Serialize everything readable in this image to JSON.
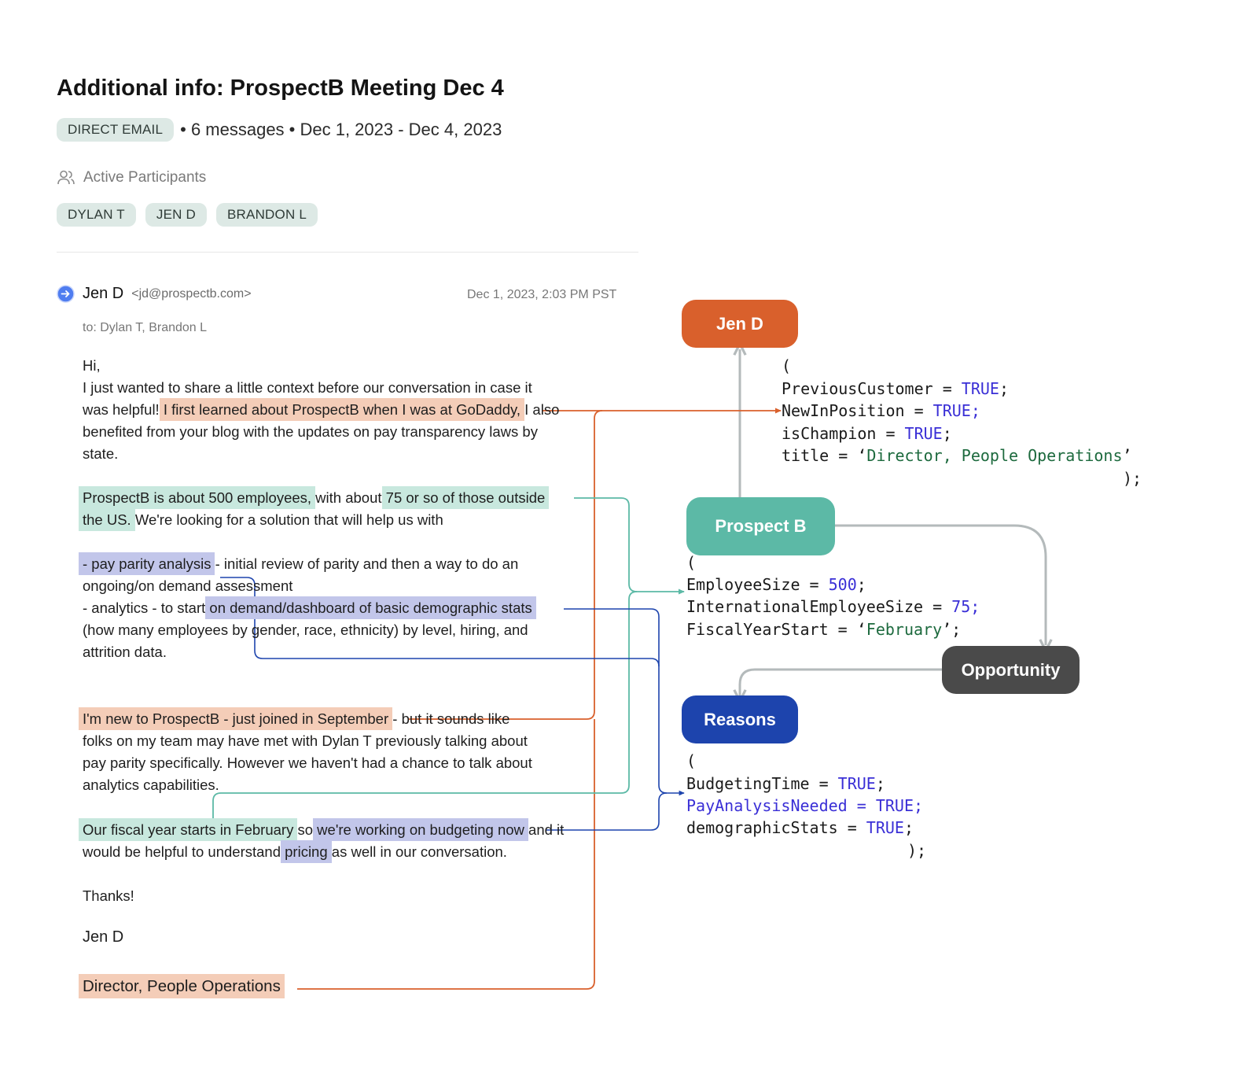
{
  "header": {
    "title": "Additional info: ProspectB Meeting Dec 4",
    "channel_tag": "DIRECT EMAIL",
    "meta": "• 6 messages • Dec 1, 2023 - Dec 4, 2023"
  },
  "participants": {
    "heading": "Active Participants",
    "chips": [
      "DYLAN T",
      "JEN D",
      "BRANDON L"
    ]
  },
  "email": {
    "sender_name": "Jen D",
    "sender_email": "<jd@prospectb.com>",
    "date": "Dec 1, 2023, 2:03 PM PST",
    "to": "to: Dylan T, Brandon L",
    "greeting": "Hi,",
    "p1_l1": "I just wanted to share a little context before our conversation in case it",
    "p1_l2a": "was helpful! ",
    "p1_l2_hl": "I first learned about ProspectB when I was at GoDaddy,",
    "p1_l2b": " I also",
    "p1_l3": "benefited from your blog with the updates on pay transparency laws by",
    "p1_l4": "state.",
    "p2_l1_hl1": "ProspectB is about 500 employees,",
    "p2_l1_mid": " with about ",
    "p2_l1_hl2": "75 or so of those outside",
    "p2_l2_hl": "the US.",
    "p2_l2b": " We're looking for a solution that will help us with",
    "p3_l1_hl": "- pay parity analysis",
    "p3_l1b": " - initial review of parity and then a way to do an",
    "p3_l2": "ongoing/on demand assessment",
    "p3_l3a": "- analytics - to start ",
    "p3_l3_hl": "on demand/dashboard of basic demographic stats",
    "p3_l4": "(how many employees by gender, race, ethnicity) by level, hiring, and",
    "p3_l5": "attrition data.",
    "p4_l1_hl": "I'm new to ProspectB - just joined in September",
    "p4_l1b": " - but it sounds like",
    "p4_l2": "folks on my team may have met with Dylan T previously talking about",
    "p4_l3": "pay parity specifically. However we haven't had a chance to talk about",
    "p4_l4": "analytics capabilities.",
    "p5_l1_hl1": "Our fiscal year starts in February",
    "p5_l1_mid": " so ",
    "p5_l1_hl2": "we're working on budgeting now",
    "p5_l1b": " and it",
    "p5_l2a": "would be helpful to understand ",
    "p5_l2_hl": "pricing",
    "p5_l2b": " as well in our conversation.",
    "thanks": "Thanks!",
    "signature": "Jen D",
    "title_hl": "Director, People Operations"
  },
  "diagram": {
    "nodes": {
      "jen_d": "Jen D",
      "prospect_b": "Prospect B",
      "opportunity": "Opportunity",
      "reasons": "Reasons"
    },
    "jen_code": {
      "open": "(",
      "l1_key": "PreviousCustomer = ",
      "l1_val": "TRUE",
      "l1_end": ";",
      "l2_key": "NewInPosition = ",
      "l2_val": "TRUE;",
      "l3_key": "isChampion = ",
      "l3_val": "TRUE",
      "l3_end": ";",
      "l4_key": "title = ‘",
      "l4_val": "Director, People Operations",
      "l4_end": "’",
      "close": ");"
    },
    "prospect_code": {
      "open": "(",
      "l1_key": "EmployeeSize = ",
      "l1_val": "500",
      "l1_end": ";",
      "l2_key": "InternationalEmployeeSize = ",
      "l2_val": "75;",
      "l3_key": "FiscalYearStart = ‘",
      "l3_val": "February",
      "l3_end": "’;"
    },
    "reasons_code": {
      "open": "(",
      "l1_key": "BudgetingTime = ",
      "l1_val": "TRUE",
      "l1_end": ";",
      "l2_key": "PayAnalysisNeeded ",
      "l2_val": "= TRUE;",
      "l3_key": "demographicStats = ",
      "l3_val": "TRUE",
      "l3_end": ";",
      "close": ");"
    }
  },
  "colors": {
    "orange": "#d9602c",
    "teal": "#5cb9a6",
    "blue": "#1d44ad",
    "dark": "#4a4a4a",
    "gray_line": "#b4babb"
  }
}
